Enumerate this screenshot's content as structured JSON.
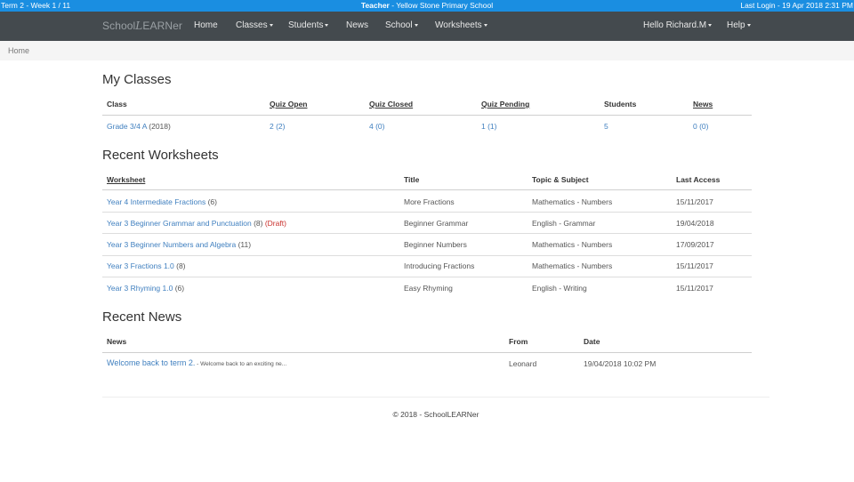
{
  "topbar": {
    "term": "Term 2 - Week 1 / 11",
    "role": "Teacher",
    "school": " - Yellow Stone Primary School",
    "last_login": "Last Login - 19 Apr 2018 2:31 PM"
  },
  "nav": {
    "brand_pre": "School",
    "brand_script": "L",
    "brand_post": "EARNer",
    "items": {
      "home": "Home",
      "classes": "Classes",
      "students": "Students",
      "news": "News",
      "school": "School",
      "worksheets": "Worksheets",
      "user": "Hello Richard.M",
      "help": "Help"
    }
  },
  "breadcrumb": "Home",
  "my_classes": {
    "title": "My Classes",
    "headers": [
      "Class",
      "Quiz Open",
      "Quiz Closed",
      "Quiz Pending",
      "Students",
      "News"
    ],
    "rows": [
      {
        "class_link": "Grade 3/4 A",
        "class_year": " (2018)",
        "quiz_open": "2 (2)",
        "quiz_closed": "4 (0)",
        "quiz_pending": "1 (1)",
        "students": "5",
        "news": "0 (0)"
      }
    ]
  },
  "recent_worksheets": {
    "title": "Recent Worksheets",
    "headers": [
      "Worksheet",
      "Title",
      "Topic & Subject",
      "Last Access"
    ],
    "rows": [
      {
        "worksheet": "Year 4 Intermediate Fractions",
        "count": " (6)",
        "draft": "",
        "title": "More Fractions",
        "topic": "Mathematics - Numbers",
        "last_access": "15/11/2017"
      },
      {
        "worksheet": "Year 3 Beginner Grammar and Punctuation",
        "count": " (8) ",
        "draft": "(Draft)",
        "title": "Beginner Grammar",
        "topic": "English - Grammar",
        "last_access": "19/04/2018"
      },
      {
        "worksheet": "Year 3 Beginner Numbers and Algebra",
        "count": " (11)",
        "draft": "",
        "title": "Beginner Numbers",
        "topic": "Mathematics - Numbers",
        "last_access": "17/09/2017"
      },
      {
        "worksheet": "Year 3 Fractions 1.0",
        "count": " (8)",
        "draft": "",
        "title": "Introducing Fractions",
        "topic": "Mathematics - Numbers",
        "last_access": "15/11/2017"
      },
      {
        "worksheet": "Year 3 Rhyming 1.0",
        "count": " (6)",
        "draft": "",
        "title": "Easy Rhyming",
        "topic": "English - Writing",
        "last_access": "15/11/2017"
      }
    ]
  },
  "recent_news": {
    "title": "Recent News",
    "headers": [
      "News",
      "From",
      "Date"
    ],
    "rows": [
      {
        "headline": "Welcome back to term 2.",
        "snippet": " - Welcome back to an exciting ne...",
        "from": "Leonard",
        "date": "19/04/2018 10:02 PM"
      }
    ]
  },
  "footer": "© 2018 - SchoolLEARNer"
}
